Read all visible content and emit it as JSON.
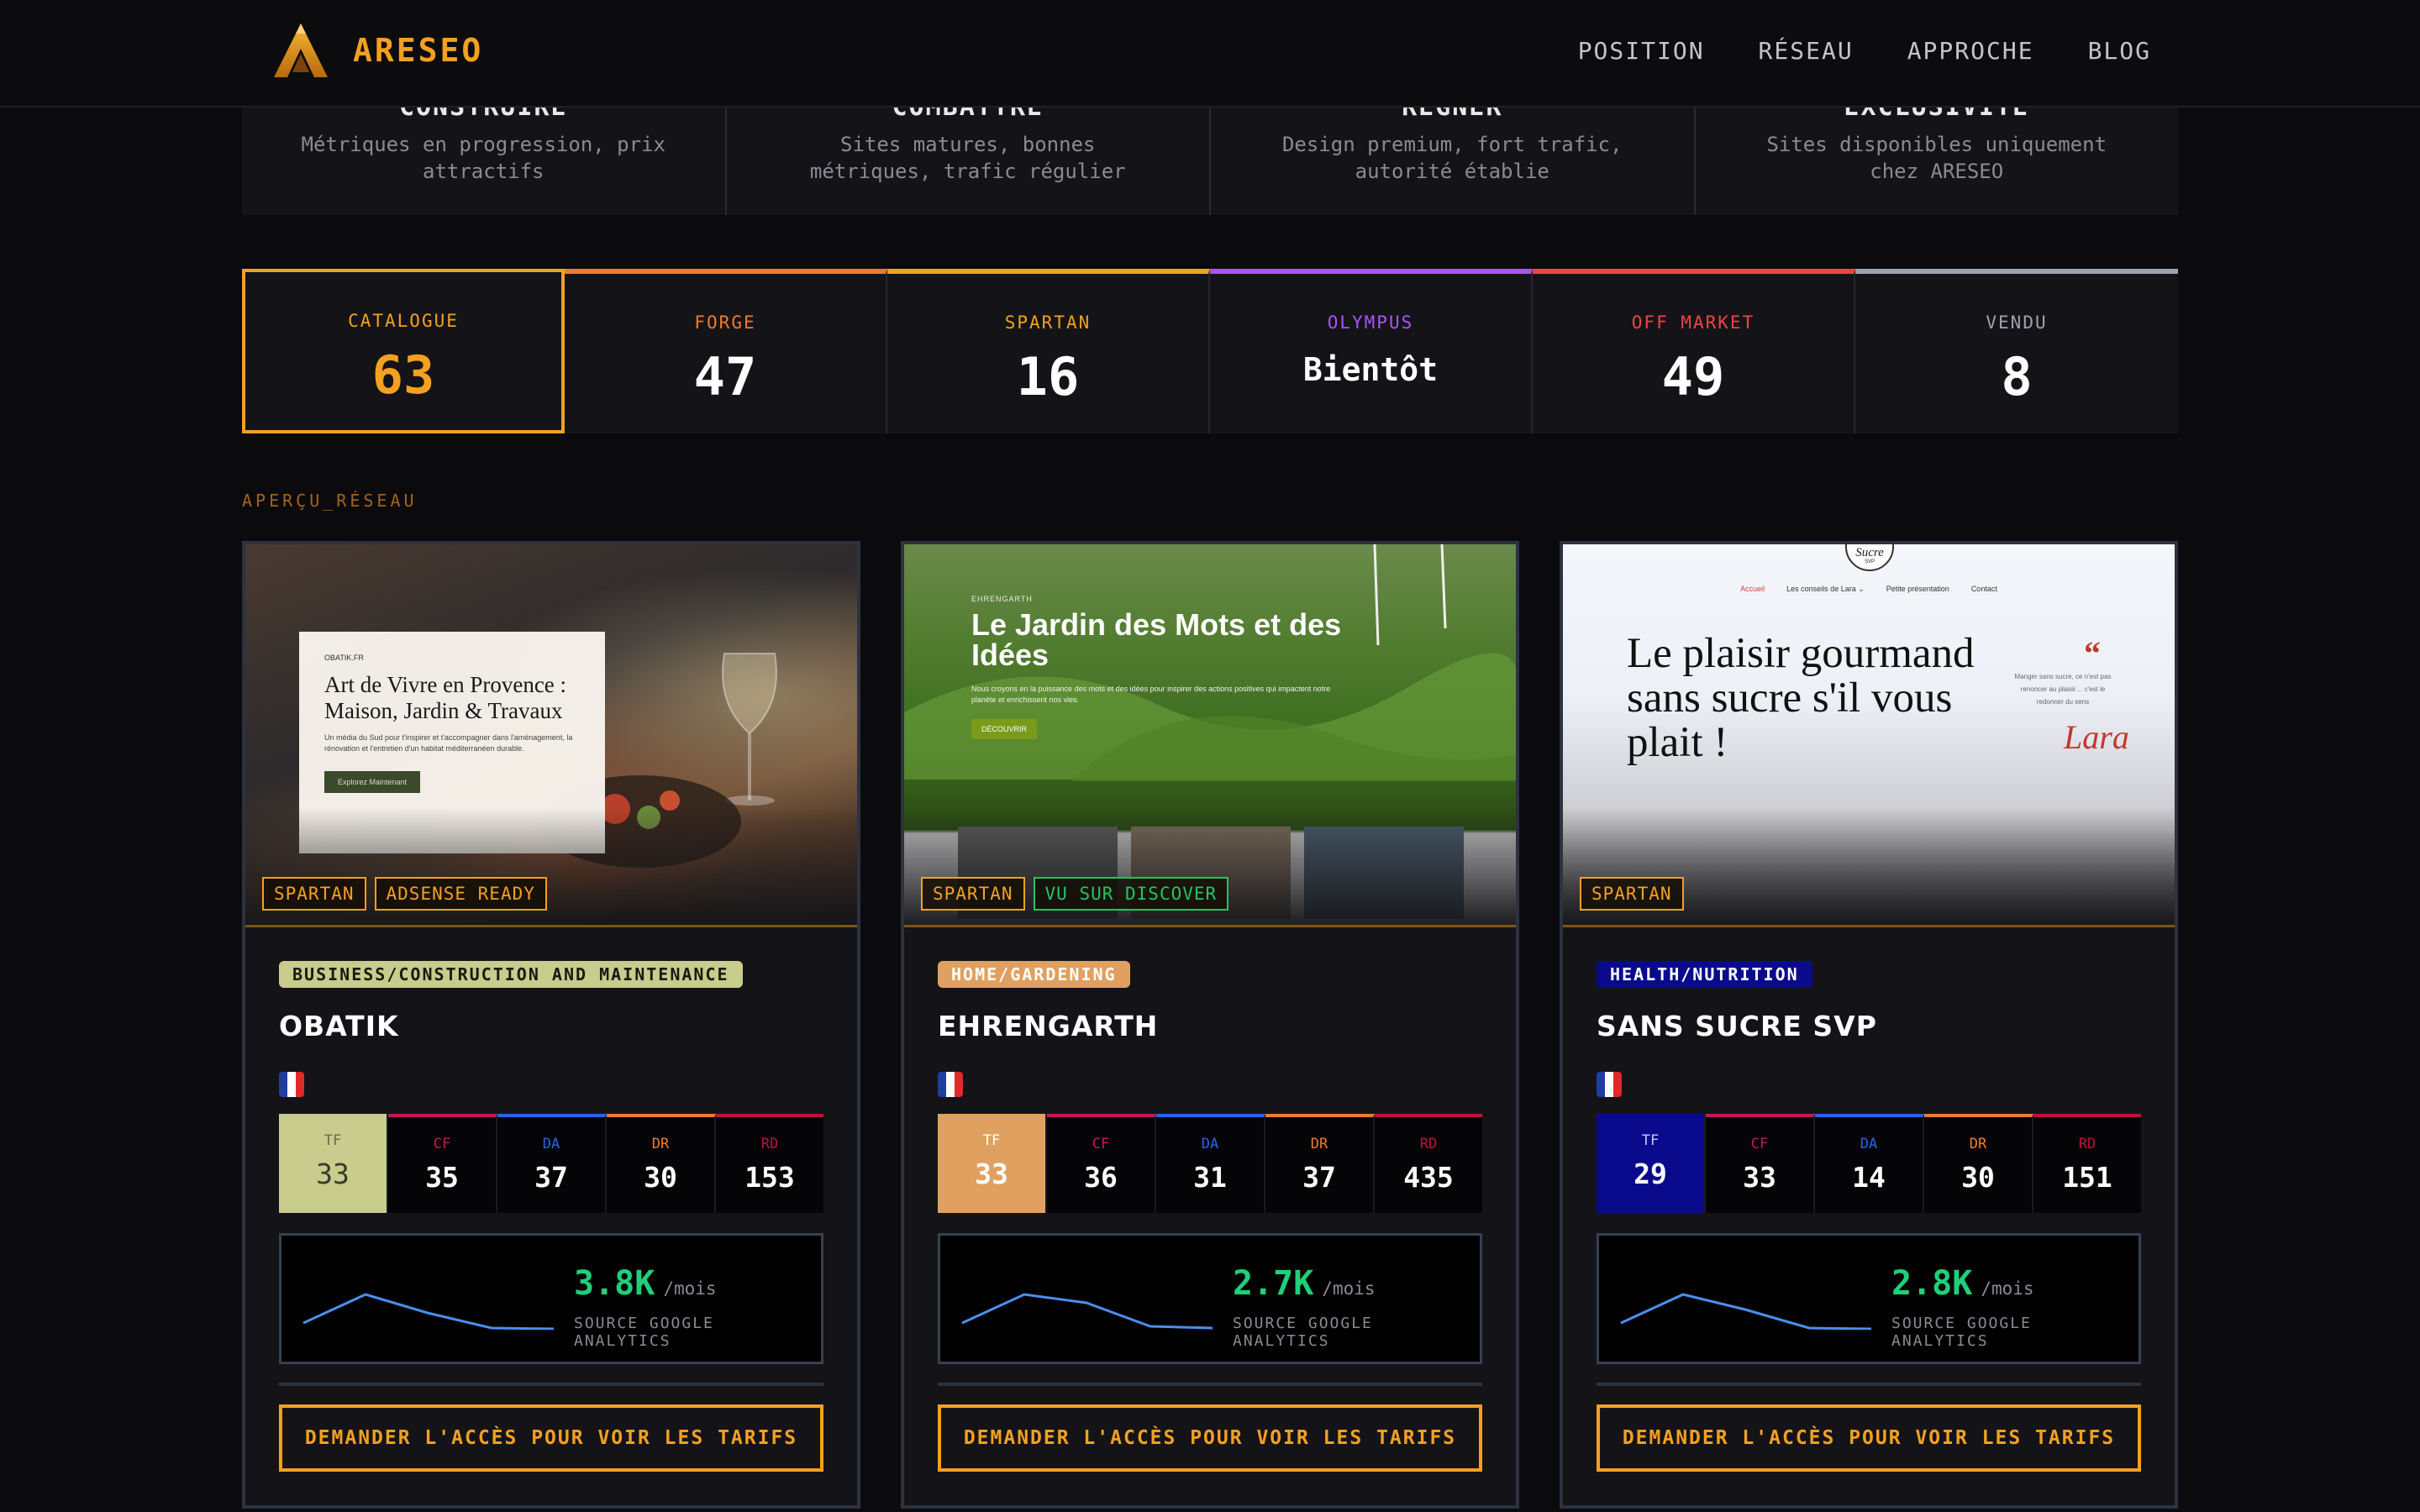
{
  "header": {
    "brand": "ARESEO",
    "nav": [
      "POSITION",
      "RÉSEAU",
      "APPROCHE",
      "BLOG"
    ]
  },
  "features": [
    {
      "title": "CONSTRUIRE",
      "desc": "Métriques en progression, prix attractifs"
    },
    {
      "title": "COMBATTRE",
      "desc": "Sites matures, bonnes métriques, trafic régulier"
    },
    {
      "title": "RÉGNER",
      "desc": "Design premium, fort trafic, autorité établie"
    },
    {
      "title": "EXCLUSIVITÉ",
      "desc": "Sites disponibles uniquement chez ARESEO"
    }
  ],
  "stats": [
    {
      "label": "CATALOGUE",
      "value": "63",
      "color": "#f4a020"
    },
    {
      "label": "FORGE",
      "value": "47",
      "color": "#f07a2a"
    },
    {
      "label": "SPARTAN",
      "value": "16",
      "color": "#f4a020"
    },
    {
      "label": "OLYMPUS",
      "value": "Bientôt",
      "color": "#a855f7"
    },
    {
      "label": "OFF MARKET",
      "value": "49",
      "color": "#ef4444"
    },
    {
      "label": "VENDU",
      "value": "8",
      "color": "#9ca3af"
    }
  ],
  "section_label": "APERÇU_RÉSEAU",
  "metric_labels": {
    "tf": "TF",
    "cf": "CF",
    "da": "DA",
    "dr": "DR",
    "rd": "RD"
  },
  "metric_colors": {
    "cf": "#c2185b",
    "da": "#2563eb",
    "dr": "#f07a2a",
    "rd": "#be123c"
  },
  "traffic_unit": "/mois",
  "traffic_source": "SOURCE GOOGLE ANALYTICS",
  "cta_label": "DEMANDER L'ACCÈS POUR VOIR LES TARIFS",
  "cards": [
    {
      "badges": [
        "SPARTAN",
        "ADSENSE READY"
      ],
      "category": "BUSINESS/CONSTRUCTION AND MAINTENANCE",
      "category_bg": "#c8cc8c",
      "category_fg": "#1a1a10",
      "name": "OBATIK",
      "tf_bg": "#c8cc8c",
      "tf_fg": "#3a3a2a",
      "metrics": {
        "tf": "33",
        "cf": "35",
        "da": "37",
        "dr": "30",
        "rd": "153"
      },
      "traffic": "3.8K",
      "thumb": {
        "site": "OBATIK.FR",
        "headline": "Art de Vivre en Provence : Maison, Jardin & Travaux",
        "text": "Un média du Sud pour t'inspirer et t'accompagner dans l'aménagement, la rénovation et l'entretien d'un habitat méditerranéen durable.",
        "button": "Explorez Maintenant"
      }
    },
    {
      "badges": [
        "SPARTAN",
        "VU SUR DISCOVER"
      ],
      "category": "HOME/GARDENING",
      "category_bg": "#e0a060",
      "category_fg": "#ffffff",
      "name": "EHRENGARTH",
      "tf_bg": "#e0a060",
      "tf_fg": "#ffffff",
      "metrics": {
        "tf": "33",
        "cf": "36",
        "da": "31",
        "dr": "37",
        "rd": "435"
      },
      "traffic": "2.7K",
      "thumb": {
        "site": "EHRENGARTH",
        "headline": "Le Jardin des Mots et des Idées",
        "text": "Nous croyons en la puissance des mots et des idées pour inspirer des actions positives qui impactent notre planète et enrichissent nos vies.",
        "button": "DÉCOUVRIR"
      }
    },
    {
      "badges": [
        "SPARTAN"
      ],
      "category": "HEALTH/NUTRITION",
      "category_bg": "#0a0a8c",
      "category_fg": "#ffffff",
      "name": "SANS SUCRE SVP",
      "tf_bg": "#0a0a8c",
      "tf_fg": "#ffffff",
      "metrics": {
        "tf": "29",
        "cf": "33",
        "da": "14",
        "dr": "30",
        "rd": "151"
      },
      "traffic": "2.8K",
      "thumb": {
        "logo": "Sucre",
        "logo_sub": "SVP",
        "nav": [
          "Accueil",
          "Les conseils de Lara ⌄",
          "Petite présentation",
          "Contact"
        ],
        "headline": "Le plaisir gourmand sans sucre s'il vous plait !",
        "quote": "Manger sans sucre, ce n'est pas renoncer au plaisir… c'est le redonner du sens",
        "signature": "Lara"
      }
    }
  ]
}
